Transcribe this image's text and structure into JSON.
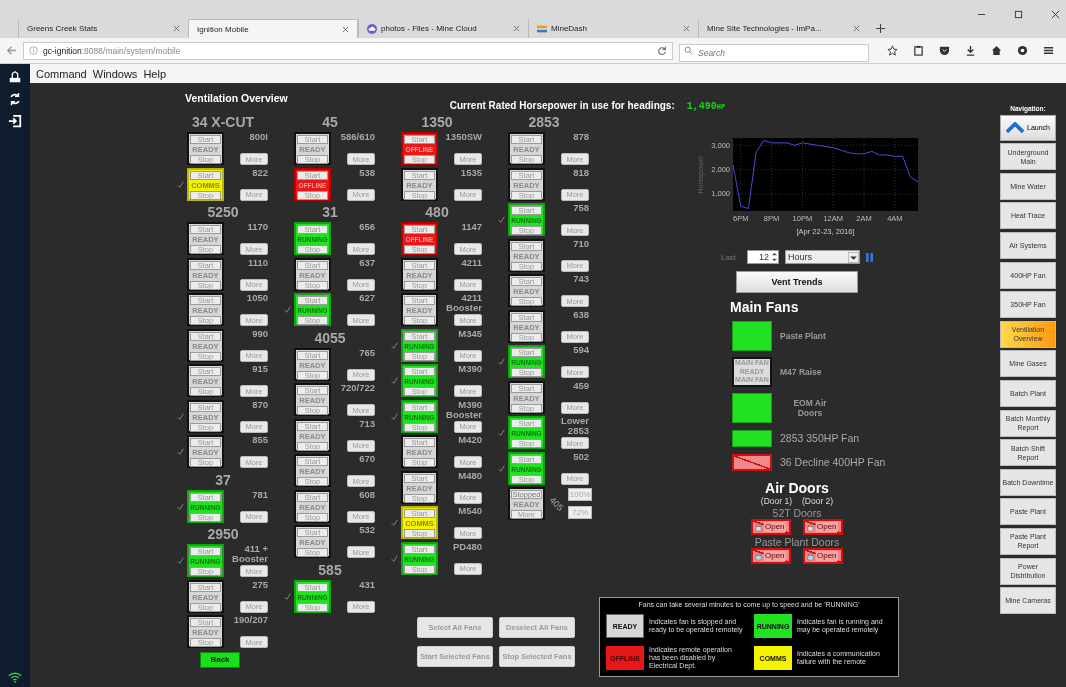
{
  "browser": {
    "tabs": [
      {
        "title": "Greens Creek Stats",
        "selected": false
      },
      {
        "title": "Ignition Mobile",
        "selected": true
      },
      {
        "title": "photos - Files - Mine Cloud",
        "selected": false
      },
      {
        "title": "MineDash",
        "selected": false
      },
      {
        "title": "Mine Site Technologies - ImPa...",
        "selected": false
      }
    ],
    "address_host": "gc-ignition",
    "address_rest": ":8088/main/system/mobile",
    "search": {
      "placeholder": "Search"
    }
  },
  "menu": [
    "Command",
    "Windows",
    "Help"
  ],
  "title": "Ventilation Overview",
  "horsepower": {
    "label": "Current Rated Horsepower in use for headings:",
    "value": "1,490",
    "unit": "HP"
  },
  "columns": [
    {
      "groups": [
        {
          "heading": "34 X-CUT",
          "fans": [
            {
              "kind": "ready",
              "label": "800I",
              "status_text": "READY",
              "start": "Start",
              "stop": "Stop",
              "more": "More",
              "checked": false
            },
            {
              "kind": "comms",
              "label": "822",
              "status_text": "COMMS",
              "start": "Start",
              "stop": "Stop",
              "more": "More",
              "checked": true
            }
          ]
        },
        {
          "heading": "5250",
          "fans": [
            {
              "kind": "ready",
              "label": "1170",
              "status_text": "READY",
              "start": "Start",
              "stop": "Stop",
              "more": "More",
              "checked": false
            },
            {
              "kind": "ready",
              "label": "1110",
              "status_text": "READY",
              "start": "Start",
              "stop": "Stop",
              "more": "More",
              "checked": false
            },
            {
              "kind": "ready",
              "label": "1050",
              "status_text": "READY",
              "start": "Start",
              "stop": "Stop",
              "more": "More",
              "checked": false
            },
            {
              "kind": "ready",
              "label": "990",
              "status_text": "READY",
              "start": "Start",
              "stop": "Stop",
              "more": "More",
              "checked": false
            },
            {
              "kind": "ready",
              "label": "915",
              "status_text": "READY",
              "start": "Start",
              "stop": "Stop",
              "more": "More",
              "checked": false
            },
            {
              "kind": "ready",
              "label": "870",
              "status_text": "READY",
              "start": "Start",
              "stop": "Stop",
              "more": "More",
              "checked": true
            },
            {
              "kind": "ready",
              "label": "855",
              "status_text": "READY",
              "start": "Start",
              "stop": "Stop",
              "more": "More",
              "checked": true
            }
          ]
        },
        {
          "heading": "37",
          "fans": [
            {
              "kind": "running",
              "label": "781",
              "status_text": "RUNNING",
              "start": "Start",
              "stop": "Stop",
              "more": "More",
              "checked": true
            }
          ]
        },
        {
          "heading": "2950",
          "fans": [
            {
              "kind": "running",
              "label": "411 + Booster",
              "status_text": "RUNNING",
              "start": "Start",
              "stop": "Stop",
              "more": "More",
              "checked": true
            },
            {
              "kind": "ready",
              "label": "275",
              "status_text": "READY",
              "start": "Start",
              "stop": "Stop",
              "more": "More",
              "checked": false
            },
            {
              "kind": "ready",
              "label": "190/207",
              "status_text": "READY",
              "start": "Start",
              "stop": "Stop",
              "more": "More",
              "checked": false
            }
          ]
        }
      ],
      "back_button": "Back"
    },
    {
      "groups": [
        {
          "heading": "45",
          "fans": [
            {
              "kind": "ready",
              "label": "586/610",
              "status_text": "READY",
              "start": "Start",
              "stop": "Stop",
              "more": "More",
              "checked": false
            },
            {
              "kind": "offline",
              "label": "538",
              "status_text": "OFFLINE",
              "start": "Start",
              "stop": "Stop",
              "more": "More",
              "checked": false
            }
          ]
        },
        {
          "heading": "31",
          "fans": [
            {
              "kind": "running",
              "label": "656",
              "status_text": "RUNNING",
              "start": "Start",
              "stop": "Stop",
              "more": "More",
              "checked": false
            },
            {
              "kind": "ready",
              "label": "637",
              "status_text": "READY",
              "start": "Start",
              "stop": "Stop",
              "more": "More",
              "checked": false
            },
            {
              "kind": "running",
              "label": "627",
              "status_text": "RUNNING",
              "start": "Start",
              "stop": "Stop",
              "more": "More",
              "checked": true
            }
          ]
        },
        {
          "heading": "4055",
          "fans": [
            {
              "kind": "ready",
              "label": "765",
              "status_text": "READY",
              "start": "Start",
              "stop": "Stop",
              "more": "More",
              "checked": false
            },
            {
              "kind": "ready",
              "label": "720/722",
              "status_text": "READY",
              "start": "Start",
              "stop": "Stop",
              "more": "More",
              "checked": false
            },
            {
              "kind": "ready",
              "label": "713",
              "status_text": "READY",
              "start": "Start",
              "stop": "Stop",
              "more": "More",
              "checked": false
            },
            {
              "kind": "ready",
              "label": "670",
              "status_text": "READY",
              "start": "Start",
              "stop": "Stop",
              "more": "More",
              "checked": false
            },
            {
              "kind": "ready",
              "label": "608",
              "status_text": "READY",
              "start": "Start",
              "stop": "Stop",
              "more": "More",
              "checked": false
            },
            {
              "kind": "ready",
              "label": "532",
              "status_text": "READY",
              "start": "Start",
              "stop": "Stop",
              "more": "More",
              "checked": false
            }
          ]
        },
        {
          "heading": "585",
          "fans": [
            {
              "kind": "running",
              "label": "431",
              "status_text": "RUNNING",
              "start": "Start",
              "stop": "Stop",
              "more": "More",
              "checked": true
            }
          ]
        }
      ]
    },
    {
      "groups": [
        {
          "heading": "1350",
          "fans": [
            {
              "kind": "offline",
              "label": "1350SW",
              "status_text": "OFFLINE",
              "start": "Start",
              "stop": "Stop",
              "more": "More",
              "checked": false
            },
            {
              "kind": "ready",
              "label": "1535",
              "status_text": "READY",
              "start": "Start",
              "stop": "Stop",
              "more": "More",
              "checked": false
            }
          ]
        },
        {
          "heading": "480",
          "fans": [
            {
              "kind": "offline",
              "label": "1147",
              "status_text": "OFFLINE",
              "start": "Start",
              "stop": "Stop",
              "more": "More",
              "checked": false
            },
            {
              "kind": "ready",
              "label": "4211",
              "status_text": "READY",
              "start": "Start",
              "stop": "Stop",
              "more": "More",
              "checked": false
            },
            {
              "kind": "ready",
              "label": "4211 Booster",
              "status_text": "READY",
              "start": "Start",
              "stop": "Stop",
              "more": "More",
              "checked": false
            },
            {
              "kind": "running",
              "label": "M345",
              "status_text": "RUNNING",
              "start": "Start",
              "stop": "Stop",
              "more": "More",
              "checked": true
            },
            {
              "kind": "running",
              "label": "M390",
              "status_text": "RUNNING",
              "start": "Start",
              "stop": "Stop",
              "more": "More",
              "checked": true
            },
            {
              "kind": "running",
              "label": "M390 Booster",
              "status_text": "RUNNING",
              "start": "Start",
              "stop": "Stop",
              "more": "More",
              "checked": true
            },
            {
              "kind": "ready",
              "label": "M420",
              "status_text": "READY",
              "start": "Start",
              "stop": "Stop",
              "more": "More",
              "checked": false
            },
            {
              "kind": "ready",
              "label": "M480",
              "status_text": "READY",
              "start": "Start",
              "stop": "Stop",
              "more": "More",
              "checked": false
            },
            {
              "kind": "comms",
              "label": "M540",
              "status_text": "COMMS",
              "start": "Start",
              "stop": "Stop",
              "more": "More",
              "checked": true
            },
            {
              "kind": "running",
              "label": "PD480",
              "status_text": "RUNNING",
              "start": "Start",
              "stop": "Stop",
              "more": "More",
              "checked": true
            }
          ]
        }
      ]
    },
    {
      "groups": [
        {
          "heading": "2853",
          "fans": [
            {
              "kind": "ready",
              "label": "878",
              "status_text": "READY",
              "start": "Start",
              "stop": "Stop",
              "more": "More",
              "checked": false
            },
            {
              "kind": "ready",
              "label": "818",
              "status_text": "READY",
              "start": "Start",
              "stop": "Stop",
              "more": "More",
              "checked": false
            },
            {
              "kind": "running",
              "label": "758",
              "status_text": "RUNNING",
              "start": "Start",
              "stop": "Stop",
              "more": "More",
              "checked": true
            },
            {
              "kind": "ready",
              "label": "710",
              "status_text": "READY",
              "start": "Start",
              "stop": "Stop",
              "more": "More",
              "checked": false
            },
            {
              "kind": "ready",
              "label": "743",
              "status_text": "READY",
              "start": "Start",
              "stop": "Stop",
              "more": "More",
              "checked": false
            },
            {
              "kind": "ready",
              "label": "638",
              "status_text": "READY",
              "start": "Start",
              "stop": "Stop",
              "more": "More",
              "checked": false
            },
            {
              "kind": "running",
              "label": "594",
              "status_text": "RUNNING",
              "start": "Start",
              "stop": "Stop",
              "more": "More",
              "checked": true
            },
            {
              "kind": "ready",
              "label": "459",
              "status_text": "READY",
              "start": "Start",
              "stop": "Stop",
              "more": "More",
              "checked": false
            },
            {
              "kind": "running",
              "label": "Lower 2853",
              "status_text": "RUNNING",
              "start": "Start",
              "stop": "Stop",
              "more": "More",
              "checked": true
            },
            {
              "kind": "running",
              "label": "502",
              "status_text": "RUNNING",
              "start": "Start",
              "stop": "Stop",
              "more": "More",
              "checked": true
            },
            {
              "kind": "ready",
              "label": "405",
              "status_text": "READY",
              "start": "Stopped",
              "stop": "More",
              "readings": [
                "100%",
                "72%"
              ]
            }
          ]
        }
      ]
    }
  ],
  "fan_buttons": [
    "Select All Fans",
    "Deselect All Fans",
    "Start Selected Fans",
    "Stop Selected Fans"
  ],
  "trend": {
    "chart_data": {
      "type": "line",
      "grid": true,
      "ylabel": "Horsepower",
      "xlabel": "[Apr 22-23, 2016]",
      "ylim": [
        300,
        3300
      ],
      "categories": [
        null,
        "6PM",
        null,
        null,
        null,
        "8PM",
        null,
        null,
        null,
        "10PM",
        null,
        null,
        null,
        "12AM",
        null,
        null,
        null,
        "2AM",
        null,
        null,
        null,
        "4AM",
        null,
        null,
        null
      ],
      "yticks": [
        {
          "value": 1000,
          "label": "1,000"
        },
        {
          "value": 2000,
          "label": "2,000"
        },
        {
          "value": 3000,
          "label": "3,000"
        }
      ],
      "series": [
        {
          "color": "#4a4ad8",
          "values": [
            2200,
            500,
            400,
            2700,
            3200,
            3100,
            3100,
            3100,
            3000,
            3100,
            3050,
            3000,
            2950,
            2900,
            2800,
            2700,
            2650,
            2650,
            2750,
            2600,
            2600,
            2550,
            2550,
            1700,
            1500
          ]
        }
      ]
    },
    "last_label": "Last",
    "amount": "12",
    "unit": "Hours",
    "button": "Vent Trends"
  },
  "main_fans": {
    "heading": "Main Fans",
    "items": [
      {
        "kind": "running",
        "label": "Paste Plant"
      },
      {
        "kind": "ready",
        "label": "M47 Raise",
        "box_lines": [
          "MAIN FAN",
          "READY",
          "MAIN FAN"
        ]
      },
      {
        "kind": "running",
        "label": "EOM Air Doors"
      },
      {
        "kind": "indicator",
        "label": "2853 350HP Fan"
      },
      {
        "kind": "disabled",
        "label": "36 Decline 400HP Fan"
      }
    ]
  },
  "air_doors": {
    "heading": "Air Doors",
    "door_labels": [
      "(Door 1)",
      "(Door 2)"
    ],
    "groups": [
      {
        "name": "52T Doors",
        "doors": [
          {
            "label": "Open",
            "disabled": true
          },
          {
            "label": "Open",
            "disabled": true
          }
        ]
      },
      {
        "name": "Paste Plant Doors",
        "doors": [
          {
            "label": "Open",
            "disabled": true
          },
          {
            "label": "Open",
            "disabled": true
          }
        ]
      }
    ]
  },
  "legend": {
    "note": "Fans can take several minutes to come up to speed and be 'RUNNING'",
    "entries": [
      {
        "kind": "ready",
        "swatch": "READY",
        "text": "Indicates fan is stopped and ready to be operated remotely"
      },
      {
        "kind": "running",
        "swatch": "RUNNING",
        "text": "Indicates fan is running and may be operated remotely"
      },
      {
        "kind": "offline",
        "swatch": "OFFLINE",
        "text": "Indicates remote operation has been disabled by Electrical Dept."
      },
      {
        "kind": "comms",
        "swatch": "COMMS",
        "text": "Indicates a communication failure with the remote"
      }
    ]
  },
  "navigation": {
    "title": "Navigation:",
    "launch": "Launch",
    "items": [
      {
        "label": "Underground Main",
        "selected": false
      },
      {
        "label": "Mine Water",
        "selected": false
      },
      {
        "label": "Heat Trace",
        "selected": false
      },
      {
        "label": "Air Systems",
        "selected": false
      },
      {
        "label": "400HP Fan",
        "selected": false
      },
      {
        "label": "350HP Fan",
        "selected": false
      },
      {
        "label": "Ventilation Overview",
        "selected": true
      },
      {
        "label": "Mine Gases",
        "selected": false
      },
      {
        "label": "Batch Plant",
        "selected": false
      },
      {
        "label": "Batch Monthly Report",
        "selected": false
      },
      {
        "label": "Batch Shift Report",
        "selected": false
      },
      {
        "label": "Batch Downtime",
        "selected": false
      },
      {
        "label": "Paste Plant",
        "selected": false
      },
      {
        "label": "Paste Plant Report",
        "selected": false
      },
      {
        "label": "Power Distribution",
        "selected": false
      },
      {
        "label": "Mine Cameras",
        "selected": false
      }
    ]
  }
}
